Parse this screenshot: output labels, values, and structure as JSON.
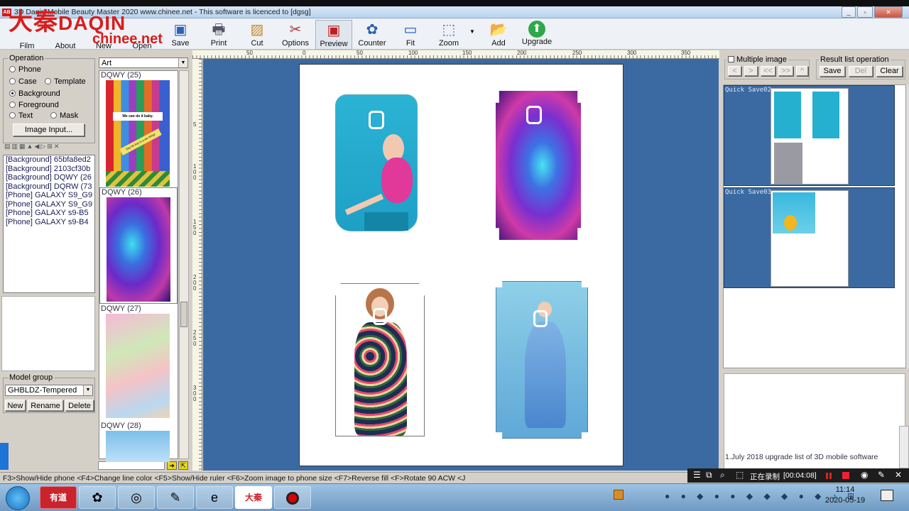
{
  "window": {
    "title": "3D Daqin Mobile Beauty Master 2020 www.chinee.net - This software is licenced to [dgsg]",
    "minimize": "_",
    "restore": "▫",
    "close": "✕"
  },
  "logo": {
    "cn": "大秦",
    "en": "DAQIN",
    "site": "chinee.net"
  },
  "toolbar": {
    "film": "Film",
    "about": "About",
    "new": "New",
    "open": "Open",
    "save": "Save",
    "print": "Print",
    "cut": "Cut",
    "options": "Options",
    "preview": "Preview",
    "counter": "Counter",
    "fit": "Fit",
    "zoom": "Zoom",
    "add": "Add",
    "upgrade": "Upgrade"
  },
  "operation": {
    "title": "Operation",
    "phone": "Phone",
    "case": "Case",
    "template": "Template",
    "background": "Background",
    "foreground": "Foreground",
    "text": "Text",
    "mask": "Mask",
    "selected": "Background",
    "image_input": "Image Input..."
  },
  "layers": [
    "[Background] 65bfa8ed2",
    "[Background] 2103cf30b",
    "[Background] DQWY (26",
    "[Background] DQRW (73",
    "[Phone] GALAXY S9_G9",
    "[Phone] GALAXY S9_G9",
    "[Phone] GALAXY s9-B5",
    "[Phone] GALAXY s9-B4"
  ],
  "model_group": {
    "title": "Model group",
    "value": "GHBLDZ-Tempered",
    "new": "New",
    "rename": "Rename",
    "delete": "Delete"
  },
  "library": {
    "category": "Art",
    "items": [
      "DQWY (25)",
      "DQWY (26)",
      "DQWY (27)",
      "DQWY (28)"
    ],
    "banner1": "We can do it baby.",
    "banner2": "Say No boy is a sex thing!"
  },
  "ruler": {
    "h_ticks": [
      "50",
      "0",
      "50",
      "100",
      "150",
      "200",
      "250",
      "300",
      "350"
    ],
    "v_ticks": [
      "5",
      "100",
      "150",
      "200",
      "250",
      "300"
    ]
  },
  "result_panel": {
    "multiple_image": "Multiple image",
    "result_list_operation": "Result list operation",
    "nav": [
      "<",
      ">",
      "<<",
      ">>",
      "^"
    ],
    "save": "Save",
    "del": "Del",
    "clear": "Clear",
    "quick_saves": [
      "Quick Save02",
      "Quick Save03"
    ]
  },
  "info": {
    "line1": "1.July 2018 upgrade list of 3D mobile software"
  },
  "statusbar": {
    "text": "F3>Show/Hide phone <F4>Change line color <F5>Show/Hide ruler <F6>Zoom image to phone size <F7>Reverse fill <F>Rotate 90 ACW <J"
  },
  "recorder": {
    "label": "正在录制",
    "time": "[00:04:08]"
  },
  "taskbar": {
    "time": "11:14",
    "date": "2020-05-19",
    "youdao": "有道",
    "daqin": "大秦"
  },
  "colors": {
    "workspace": "#3b6aa2",
    "logo_red": "#d81e1e"
  }
}
